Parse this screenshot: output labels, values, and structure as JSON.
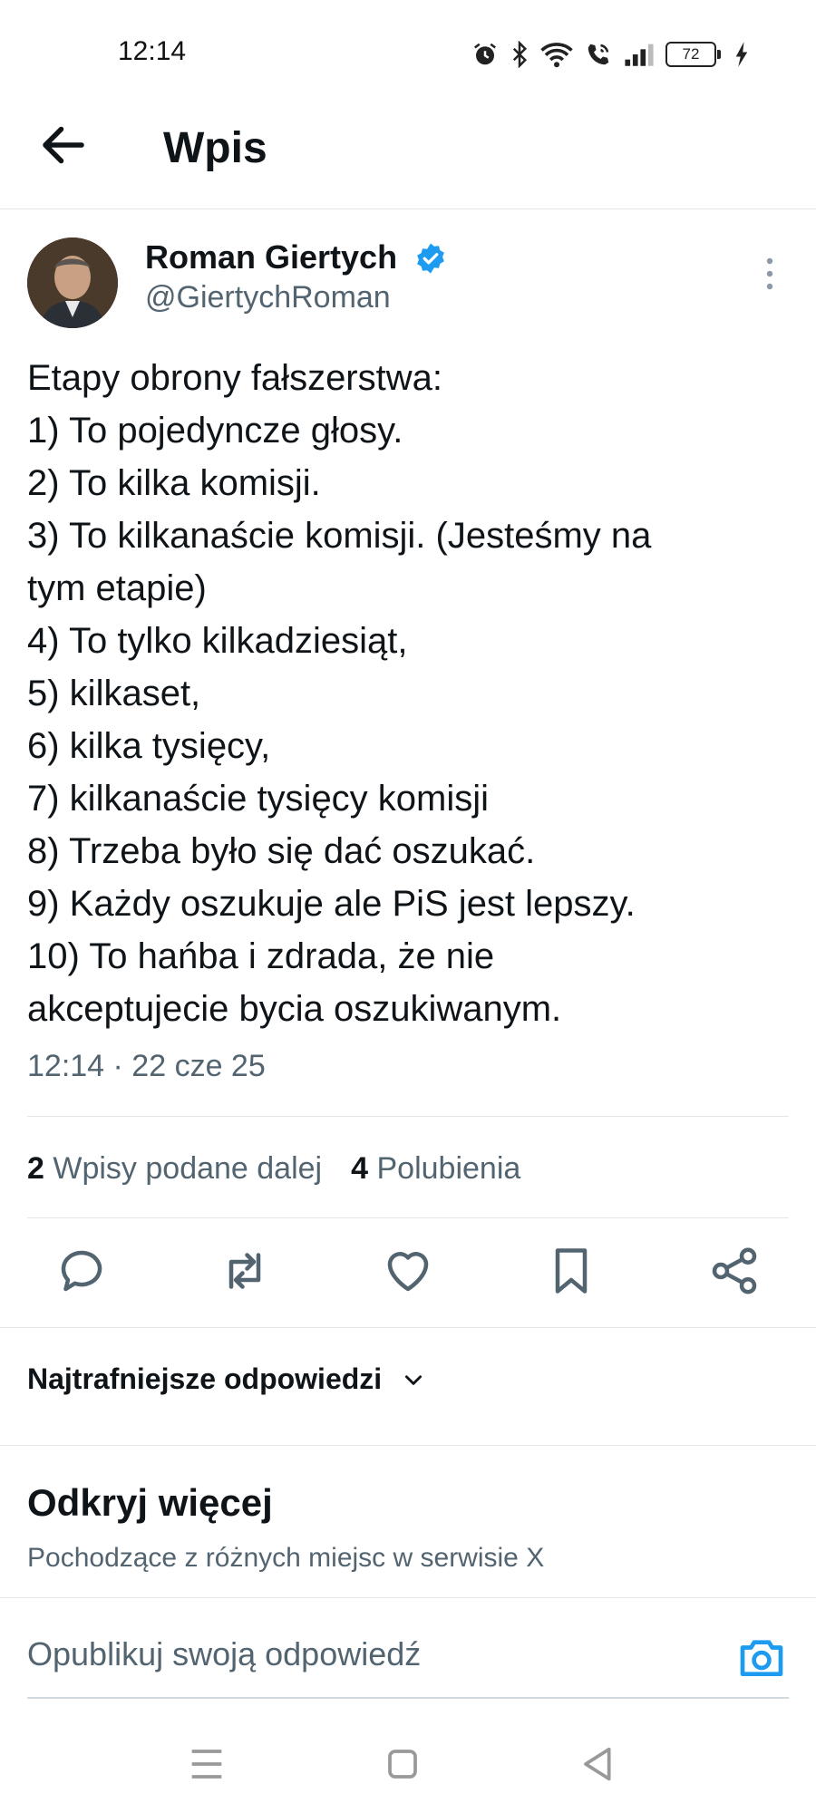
{
  "status_bar": {
    "time": "12:14",
    "battery": "72",
    "icons": [
      "alarm-icon",
      "bluetooth-icon",
      "wifi-icon",
      "wifi-call-icon",
      "signal-icon",
      "battery-icon",
      "charging-icon"
    ]
  },
  "header": {
    "title": "Wpis",
    "back_icon": "arrow-left-icon"
  },
  "post": {
    "author_name": "Roman Giertych",
    "author_handle": "@GiertychRoman",
    "verified_color": "#1d9bf0",
    "text_lines": [
      "Etapy obrony fałszerstwa:",
      "1) To pojedyncze głosy.",
      "2) To kilka komisji.",
      "3) To kilkanaście komisji. (Jesteśmy na",
      "tym etapie)",
      "4) To tylko kilkadziesiąt,",
      "5) kilkaset,",
      "6) kilka tysięcy,",
      "7) kilkanaście tysięcy komisji",
      "8) Trzeba było się dać oszukać.",
      "9) Każdy oszukuje ale PiS jest lepszy.",
      "10) To hańba i zdrada, że nie",
      "akceptujecie bycia oszukiwanym."
    ],
    "timestamp": "12:14 · 22 cze 25"
  },
  "stats": {
    "reposts_count": "2",
    "reposts_label": "Wpisy podane dalej",
    "likes_count": "4",
    "likes_label": "Polubienia"
  },
  "actions": [
    "reply-icon",
    "repost-icon",
    "like-icon",
    "bookmark-icon",
    "share-icon"
  ],
  "replies_sort": {
    "label": "Najtrafniejsze odpowiedzi"
  },
  "discover": {
    "title": "Odkryj więcej",
    "subtitle": "Pochodzące z różnych miejsc w serwisie X"
  },
  "composer": {
    "placeholder": "Opublikuj swoją odpowiedź",
    "accent_color": "#1d9bf0"
  },
  "system_nav": [
    "menu-icon",
    "home-icon",
    "back-triangle-icon"
  ]
}
